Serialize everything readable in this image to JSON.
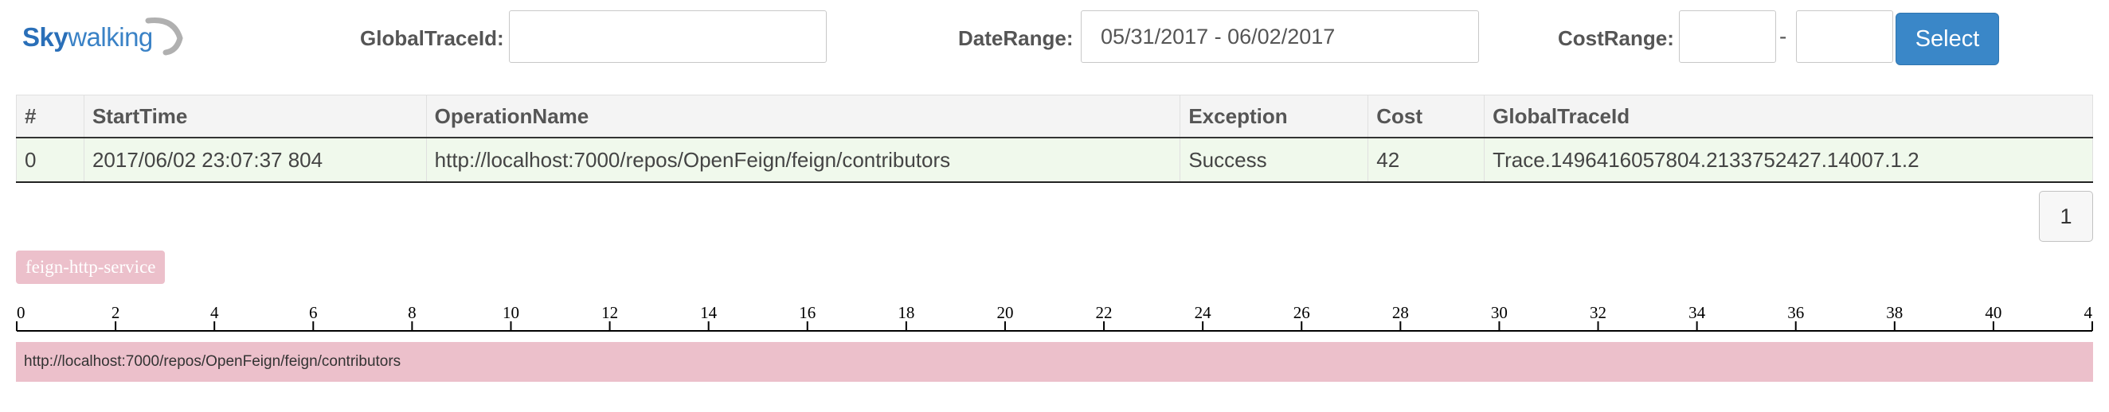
{
  "logo": {
    "part1": "Sky",
    "part2": "walking"
  },
  "search": {
    "trace_id_label": "GlobalTraceId:",
    "trace_id_value": "",
    "date_range_label": "DateRange:",
    "date_range_value": "05/31/2017 - 06/02/2017",
    "cost_range_label": "CostRange:",
    "cost_min": "",
    "cost_separator": "-",
    "cost_max": "",
    "select_label": "Select"
  },
  "table": {
    "headers": [
      "#",
      "StartTime",
      "OperationName",
      "Exception",
      "Cost",
      "GlobalTraceId"
    ],
    "rows": [
      [
        "0",
        "2017/06/02 23:07:37 804",
        "http://localhost:7000/repos/OpenFeign/feign/contributors",
        "Success",
        "42",
        "Trace.1496416057804.2133752427.14007.1.2"
      ]
    ]
  },
  "pagination": {
    "current": "1"
  },
  "app_tag": "feign-http-service",
  "timeline": {
    "ticks": [
      "0",
      "2",
      "4",
      "6",
      "8",
      "10",
      "12",
      "14",
      "16",
      "18",
      "20",
      "22",
      "24",
      "26",
      "28",
      "30",
      "32",
      "34",
      "36",
      "38",
      "40",
      "4"
    ],
    "span": {
      "label": "http://localhost:7000/repos/OpenFeign/feign/contributors",
      "start": 0,
      "cost": 42
    }
  },
  "colors": {
    "accent": "#3a87c8",
    "row_success": "#f0f9ec",
    "span": "#ecc0cb",
    "logo": "#2a6fb8"
  }
}
